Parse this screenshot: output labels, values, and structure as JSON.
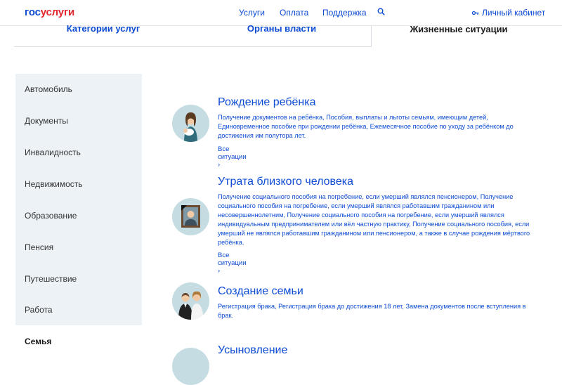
{
  "header": {
    "logo_part1": "гос",
    "logo_part2": "услуги",
    "nav": [
      "Услуги",
      "Оплата",
      "Поддержка"
    ],
    "cabinet_label": "Личный кабинет"
  },
  "tabs": [
    "Категории услуг",
    "Органы власти",
    "Жизненные ситуации"
  ],
  "sidebar": {
    "items": [
      "Автомобиль",
      "Документы",
      "Инвалидность",
      "Недвижимость",
      "Образование",
      "Пенсия",
      "Путешествие",
      "Работа",
      "Семья"
    ],
    "active": "Семья"
  },
  "sections": [
    {
      "title": "Рождение ребёнка",
      "desc": "Получение документов на ребёнка, Пособия, выплаты и льготы семьям, имеющим детей, Единовременное пособие при рождении ребёнка, Ежемесячное пособие по уходу за ребёнком до достижения им полутора лет.",
      "link": "Все ситуации"
    },
    {
      "title": "Утрата близкого человека",
      "desc": "Получение социального пособия на погребение, если умерший являлся пенсионером, Получение социального пособия на погребение, если умерший являлся работавшим гражданином или несовершеннолетним, Получение социального пособия на погребение, если умерший являлся индивидуальным предпринимателем или вёл частную практику, Получение социального пособия, если умерший не являлся работавшим гражданином или пенсионером, а также в случае рождения мёртвого ребёнка.",
      "link": "Все ситуации"
    },
    {
      "title": "Создание семьи",
      "desc": "Регистрация брака, Регистрация брака до достижения 18 лет, Замена документов после вступления в брак."
    },
    {
      "title": "Усыновление"
    }
  ]
}
